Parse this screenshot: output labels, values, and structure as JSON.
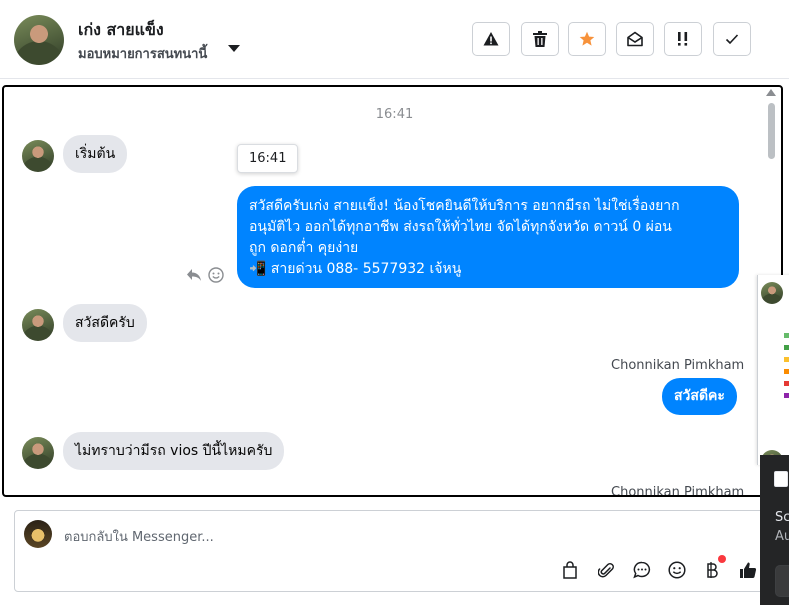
{
  "header": {
    "contact_name": "เก่ง สายแข็ง",
    "assign_label": "มอบหมายการสนทนานี้",
    "toolbar": [
      {
        "name": "warning-button",
        "icon": "warning-icon"
      },
      {
        "name": "delete-button",
        "icon": "trash-icon"
      },
      {
        "name": "star-button",
        "icon": "star-icon",
        "color": "#f7923b"
      },
      {
        "name": "mark-unread-button",
        "icon": "envelope-open-icon"
      },
      {
        "name": "follow-up-button",
        "icon": "double-exclamation-icon"
      },
      {
        "name": "mark-done-button",
        "icon": "check-icon"
      }
    ]
  },
  "chat": {
    "timestamp": "16:41",
    "tooltip_time": "16:41",
    "messages": [
      {
        "direction": "in",
        "text": "เริ่มต้น"
      },
      {
        "direction": "out",
        "lines": [
          "สวัสดีครับเก่ง สายแข็ง! น้องโชคยินดีให้บริการ อยากมีรถ ไม่ใช่เรื่องยาก",
          "อนุมัติไว ออกได้ทุกอาชีพ ส่งรถให้ทั่วไทย จัดได้ทุกจังหวัด ดาวน์ 0  ผ่อน",
          "ถูก ดอกต่ำ คุยง่าย",
          "📲 สายด่วน 088- 5577932 เจ้หนู"
        ]
      },
      {
        "direction": "in",
        "text": "สวัสดีครับ"
      },
      {
        "direction": "out",
        "sender": "Chonnikan Pimkham",
        "text": "สวัสดีคะ"
      },
      {
        "direction": "in",
        "text": "ไม่ทราบว่ามีรถ vios ปีนี้ไหมครับ"
      },
      {
        "direction": "out",
        "sender": "Chonnikan Pimkham"
      }
    ]
  },
  "composer": {
    "placeholder": "ตอบกลับใน Messenger...",
    "icons": [
      "bag-icon",
      "paperclip-icon",
      "chat-bubble-icon",
      "emoji-icon",
      "baht-icon",
      "thumbs-up-icon"
    ]
  },
  "overlay": {
    "dark_text_1": "Sc",
    "dark_text_2": "Au"
  },
  "colors": {
    "accent": "#0084ff",
    "incoming_bubble": "#e4e6eb",
    "star": "#f7923b",
    "notification": "#fa383e"
  }
}
